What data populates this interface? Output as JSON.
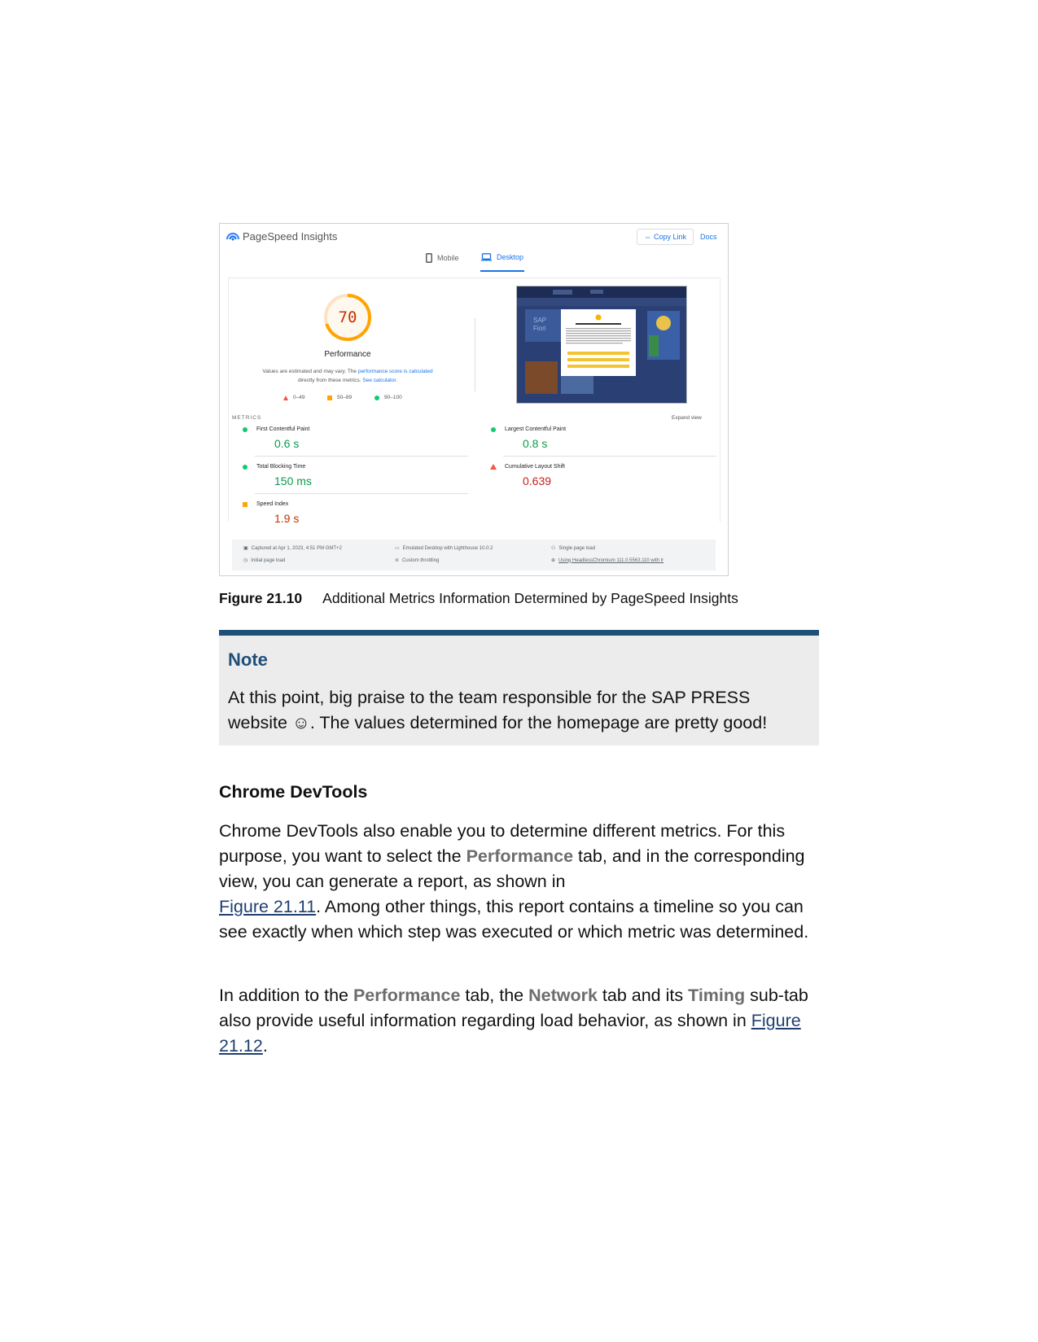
{
  "figure": {
    "app_title": "PageSpeed Insights",
    "copy_link_label": "Copy Link",
    "docs_label": "Docs",
    "tabs": [
      {
        "label": "Mobile",
        "icon": "phone-icon",
        "active": false
      },
      {
        "label": "Desktop",
        "icon": "laptop-icon",
        "active": true
      }
    ],
    "score": "70",
    "score_fraction": 0.7,
    "category_label": "Performance",
    "desc_part1": "Values are estimated and may vary. The ",
    "desc_link1": "performance score is calculated",
    "desc_part2": " directly from these metrics. ",
    "desc_link2": "See calculator.",
    "legend": [
      {
        "label": "0–49",
        "shape": "triangle",
        "color": "#ff4e42"
      },
      {
        "label": "50–89",
        "shape": "square",
        "color": "#ffa400"
      },
      {
        "label": "90–100",
        "shape": "circle",
        "color": "#0cce6b"
      }
    ],
    "metrics_label": "METRICS",
    "expand_label": "Expand view",
    "metrics": [
      {
        "name": "First Contentful Paint",
        "value": "0.6 s",
        "rating": "good"
      },
      {
        "name": "Largest Contentful Paint",
        "value": "0.8 s",
        "rating": "good"
      },
      {
        "name": "Total Blocking Time",
        "value": "150 ms",
        "rating": "good"
      },
      {
        "name": "Cumulative Layout Shift",
        "value": "0.639",
        "rating": "poor"
      },
      {
        "name": "Speed Index",
        "value": "1.9 s",
        "rating": "average"
      }
    ],
    "footer": {
      "captured": "Captured at Apr 1, 2023, 4:51 PM GMT+2",
      "initial_load": "Initial page load",
      "emulated": "Emulated Desktop with Lighthouse 10.0.2",
      "throttling": "Custom throttling",
      "single_load": "Single page load",
      "browser": "Using HeadlessChromium 111.0.5563.110 with lr"
    },
    "colors": {
      "good": "#0cce6b",
      "average": "#ffa400",
      "poor": "#ff4e42",
      "accent": "#1a73e8"
    }
  },
  "caption": {
    "number": "Figure 21.10",
    "text": "Additional Metrics Information Determined by PageSpeed Insights"
  },
  "note": {
    "title": "Note",
    "body": "At this point, big praise to the team responsible for the SAP PRESS website ☺. The values determined for the homepage are pretty good!",
    "accent_color": "#1f4e79"
  },
  "section": {
    "heading": "Chrome DevTools",
    "p1": {
      "t1": "Chrome DevTools also enable you to determine different metrics. For this purpose, you want to select the ",
      "ui1": "Performance",
      "t2": " tab, and in the corresponding view, you can generate a report, as shown in ",
      "link1": "Figure 21.11",
      "t3": ". Among other things, this report contains a timeline so you can see exactly when which step was executed or which metric was determined."
    },
    "p2": {
      "t1": "In addition to the ",
      "ui1": "Performance",
      "t2": " tab, the ",
      "ui2": "Network",
      "t3": " tab and its ",
      "ui3": "Timing",
      "t4": " sub-tab also provide useful information regarding load behavior, as shown in ",
      "link1": "Figure 21.12",
      "t5": "."
    }
  }
}
